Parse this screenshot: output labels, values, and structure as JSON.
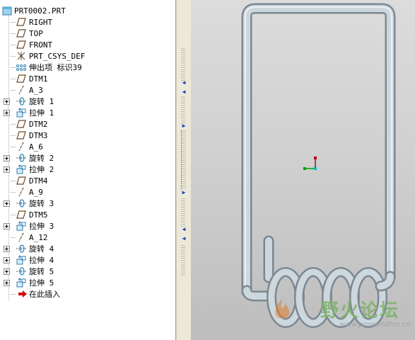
{
  "model_tree": {
    "root_label": "PRT0002.PRT",
    "items": [
      {
        "label": "RIGHT",
        "icon": "datum-plane-icon",
        "expandable": false
      },
      {
        "label": "TOP",
        "icon": "datum-plane-icon",
        "expandable": false
      },
      {
        "label": "FRONT",
        "icon": "datum-plane-icon",
        "expandable": false
      },
      {
        "label": "PRT_CSYS_DEF",
        "icon": "csys-icon",
        "expandable": false
      },
      {
        "label": "伸出项 标识39",
        "icon": "protrusion-icon",
        "expandable": false
      },
      {
        "label": "DTM1",
        "icon": "datum-plane-icon",
        "expandable": false
      },
      {
        "label": "A_3",
        "icon": "datum-axis-icon",
        "expandable": false
      },
      {
        "label": "旋转 1",
        "icon": "revolve-icon",
        "expandable": true
      },
      {
        "label": "拉伸 1",
        "icon": "extrude-icon",
        "expandable": true
      },
      {
        "label": "DTM2",
        "icon": "datum-plane-icon",
        "expandable": false
      },
      {
        "label": "DTM3",
        "icon": "datum-plane-icon",
        "expandable": false
      },
      {
        "label": "A_6",
        "icon": "datum-axis-icon",
        "expandable": false
      },
      {
        "label": "旋转 2",
        "icon": "revolve-icon",
        "expandable": true
      },
      {
        "label": "拉伸 2",
        "icon": "extrude-icon",
        "expandable": true
      },
      {
        "label": "DTM4",
        "icon": "datum-plane-icon",
        "expandable": false
      },
      {
        "label": "A_9",
        "icon": "datum-axis-icon",
        "expandable": false
      },
      {
        "label": "旋转 3",
        "icon": "revolve-icon",
        "expandable": true
      },
      {
        "label": "DTM5",
        "icon": "datum-plane-icon",
        "expandable": false
      },
      {
        "label": "拉伸 3",
        "icon": "extrude-icon",
        "expandable": true
      },
      {
        "label": "A_12",
        "icon": "datum-axis-icon",
        "expandable": false
      },
      {
        "label": "旋转 4",
        "icon": "revolve-icon",
        "expandable": true
      },
      {
        "label": "拉伸 4",
        "icon": "extrude-icon",
        "expandable": true
      },
      {
        "label": "旋转 5",
        "icon": "revolve-icon",
        "expandable": true
      },
      {
        "label": "拉伸 5",
        "icon": "extrude-icon",
        "expandable": true
      },
      {
        "label": "在此插入",
        "icon": "insert-here-arrow-icon",
        "expandable": false
      }
    ]
  },
  "watermark": {
    "title": "野火论坛",
    "url": "www.proewildfire.cn"
  },
  "colors": {
    "tree_background": "#ffffff",
    "viewport_top": "#dcdcdc",
    "viewport_bottom": "#bdbdbd",
    "wire": "#c9d3db",
    "insert_arrow": "#d40000",
    "splitter_arrow": "#1f3cc8"
  }
}
